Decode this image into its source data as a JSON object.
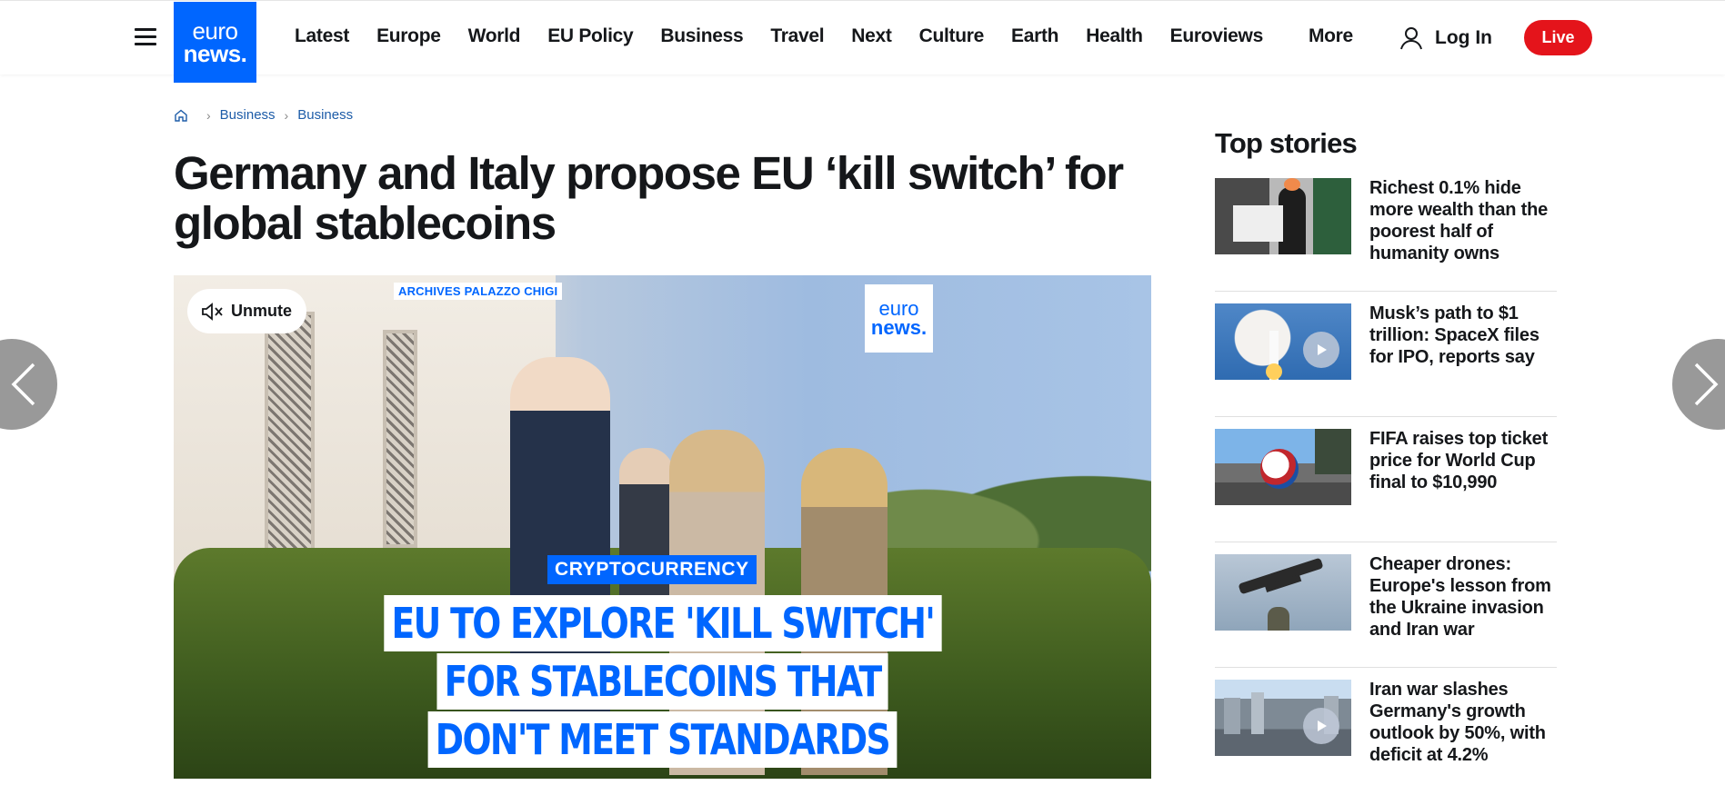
{
  "header": {
    "logo_line1": "euro",
    "logo_line2": "news.",
    "nav": [
      "Latest",
      "Europe",
      "World",
      "EU Policy",
      "Business",
      "Travel",
      "Next",
      "Culture",
      "Earth",
      "Health",
      "Euroviews"
    ],
    "more_label": "More",
    "login_label": "Log In",
    "live_label": "Live"
  },
  "breadcrumb": [
    "Business",
    "Business"
  ],
  "article": {
    "headline": "Germany and Italy propose EU ‘kill switch’ for global stablecoins"
  },
  "video": {
    "unmute_label": "Unmute",
    "source_label": "ARCHIVES PALAZZO CHIGI",
    "logo_line1": "euro",
    "logo_line2": "news.",
    "tag": "CRYPTOCURRENCY",
    "caption_lines": [
      "EU TO EXPLORE 'KILL SWITCH'",
      "FOR STABLECOINS THAT",
      "DON'T MEET STANDARDS"
    ]
  },
  "top_stories": {
    "title": "Top stories",
    "items": [
      {
        "title": "Richest 0.1% hide more wealth than the poorest half of humanity owns",
        "has_video": false
      },
      {
        "title": "Musk’s path to $1 trillion: SpaceX files for IPO, reports say",
        "has_video": true
      },
      {
        "title": "FIFA raises top ticket price for World Cup final to $10,990",
        "has_video": false
      },
      {
        "title": "Cheaper drones: Europe's lesson from the Ukraine invasion and Iran war",
        "has_video": false
      },
      {
        "title": "Iran war slashes Germany's growth outlook by 50%, with deficit at 4.2%",
        "has_video": true
      }
    ]
  },
  "colors": {
    "brand_blue": "#0066ff",
    "live_red": "#e4141b",
    "link_blue": "#1d5ca8"
  },
  "icons": [
    "menu-icon",
    "user-icon",
    "home-icon",
    "chevron-right-icon",
    "mute-icon",
    "chevron-left-icon",
    "play-icon"
  ]
}
